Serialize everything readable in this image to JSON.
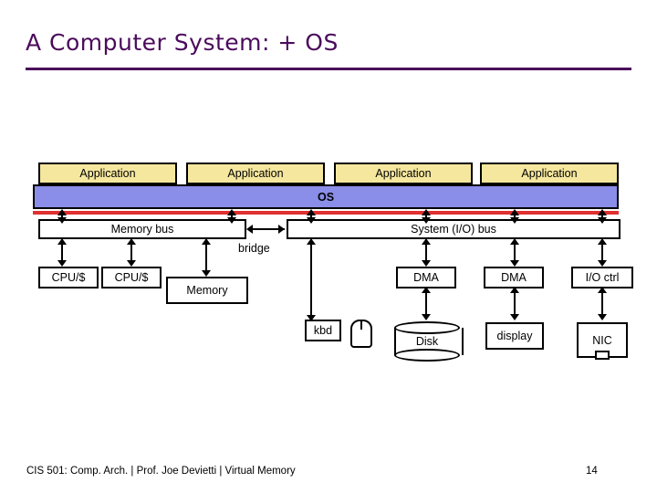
{
  "slide": {
    "title": "A Computer System: + OS",
    "footer_text": "CIS 501: Comp. Arch.  |  Prof. Joe Devietti  |  Virtual Memory",
    "page_number": "14"
  },
  "colors": {
    "title": "#4b0b5b",
    "application_fill": "#f5e79e",
    "os_fill": "#8a8ee8",
    "red_bar": "#e03030",
    "outline": "#000000"
  },
  "applications": [
    {
      "label": "Application"
    },
    {
      "label": "Application"
    },
    {
      "label": "Application"
    },
    {
      "label": "Application"
    }
  ],
  "os": {
    "label": "OS"
  },
  "buses": {
    "memory_bus": "Memory bus",
    "io_bus": "System (I/O) bus",
    "bridge": "bridge"
  },
  "components": {
    "cpu1": "CPU/$",
    "cpu2": "CPU/$",
    "memory": "Memory",
    "dma1": "DMA",
    "dma2": "DMA",
    "io_ctrl": "I/O ctrl",
    "kbd": "kbd",
    "disk": "Disk",
    "display": "display",
    "nic": "NIC"
  }
}
